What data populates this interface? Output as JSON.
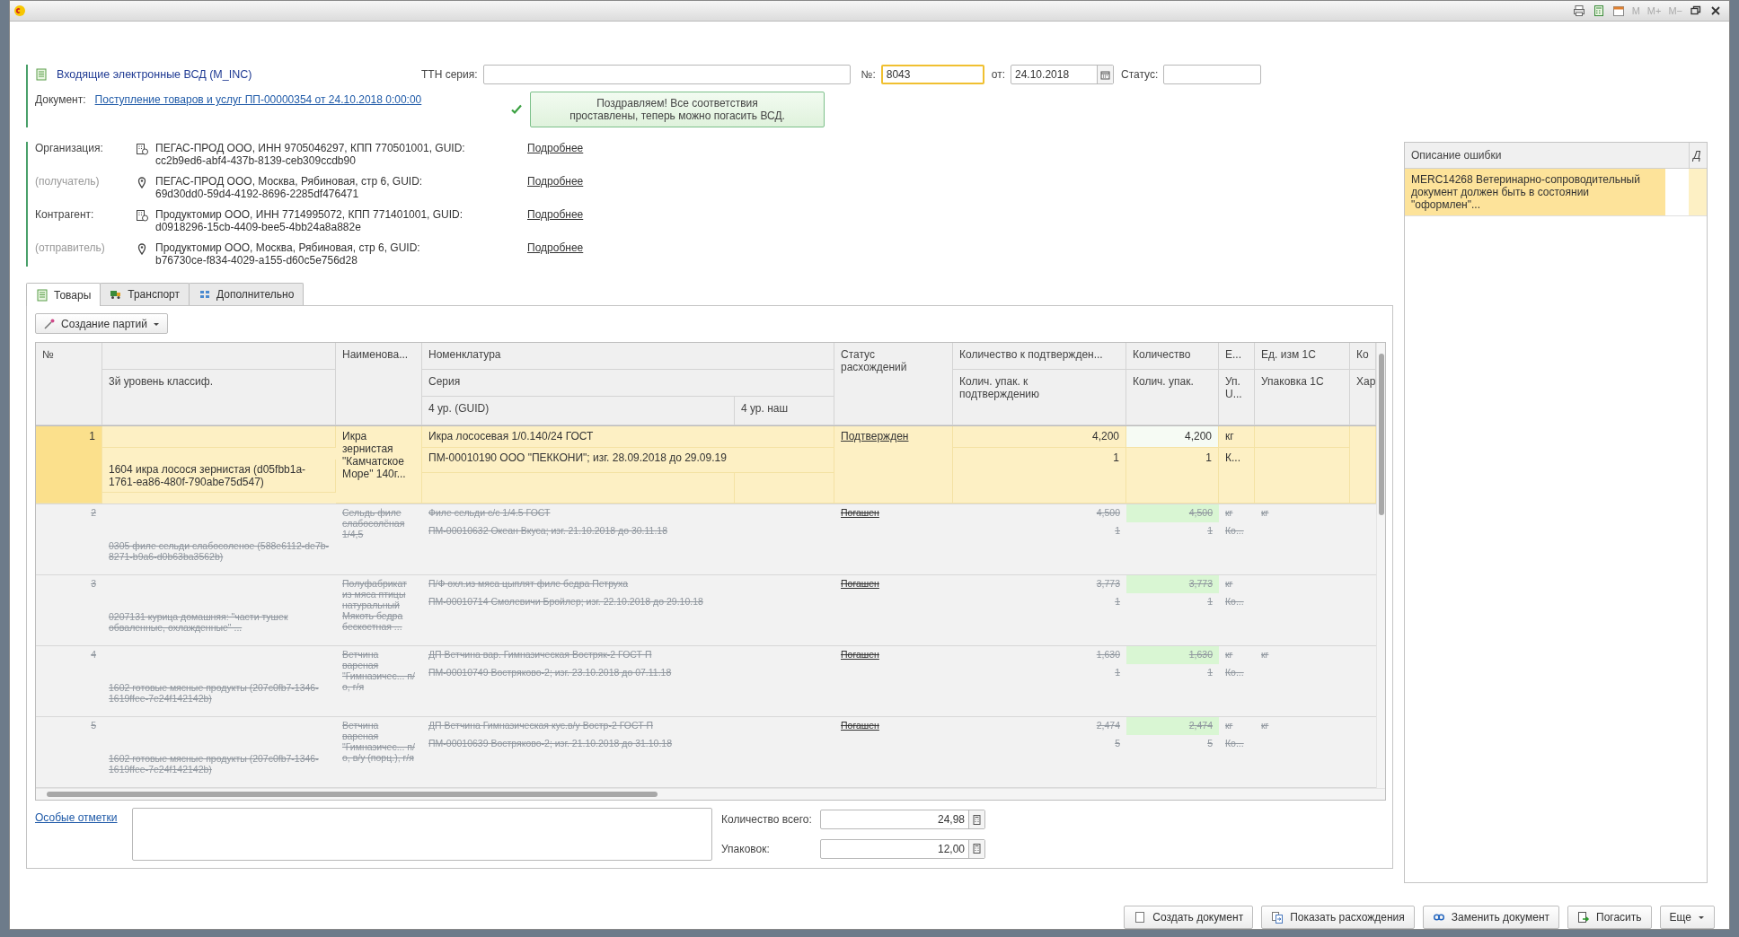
{
  "window": {
    "memory_buttons": [
      "M",
      "M+",
      "M−"
    ]
  },
  "header": {
    "title": "Входящие электронные ВСД (M_INC)",
    "ttn_label": "ТТН серия:",
    "number_label": "№:",
    "number": "8043",
    "date_label": "от:",
    "date": "24.10.2018",
    "status_label": "Статус:",
    "document_label": "Документ:",
    "document_link": "Поступление товаров и услуг ПП-00000354 от 24.10.2018 0:00:00",
    "notice": "Поздравляем! Все соответствия проставлены, теперь можно погасить ВСД."
  },
  "parties": [
    {
      "label": "Организация:",
      "muted": false,
      "kind": "organization",
      "text": "ПЕГАС-ПРОД ООО,  ИНН 9705046297, КПП 770501001, GUID:",
      "guid": "cc2b9ed6-abf4-437b-8139-ceb309ccdb90",
      "link": "Подробнее"
    },
    {
      "label": "(получатель)",
      "muted": true,
      "kind": "place",
      "text": "ПЕГАС-ПРОД ООО, Москва, Рябиновая, стр 6, GUID:",
      "guid": "69d30dd0-59d4-4192-8696-2285df476471",
      "link": "Подробнее"
    },
    {
      "label": "Контрагент:",
      "muted": false,
      "kind": "organization",
      "text": "Продуктомир ООО,  ИНН 7714995072, КПП 771401001, GUID:",
      "guid": "d0918296-15cb-4409-bee5-4bb24a8a882e",
      "link": "Подробнее"
    },
    {
      "label": "(отправитель)",
      "muted": true,
      "kind": "place",
      "text": "Продуктомир ООО, Москва, Рябиновая, стр 6, GUID:",
      "guid": "b76730ce-f834-4029-a155-d60c5e756d28",
      "link": "Подробнее"
    }
  ],
  "tabs": [
    {
      "label": "Товары",
      "kind": "goods",
      "selected": true
    },
    {
      "label": "Транспорт",
      "kind": "transport",
      "selected": false
    },
    {
      "label": "Дополнительно",
      "kind": "extra",
      "selected": false
    }
  ],
  "toolbar": {
    "create_batches": "Создание партий"
  },
  "table": {
    "header": {
      "number": "№",
      "classifier": "3й уровень классиф.",
      "name": "Наименова...",
      "nomenclature": "Номенклатура",
      "series": "Серия",
      "guid": "4 ур. (GUID)",
      "own": "4 ур. наш",
      "status": "Статус расхождений",
      "qty_to_confirm": "Количество к подтвержден...",
      "packs_to_confirm": "Колич. упак. к подтверждению",
      "qty": "Количество",
      "packs": "Колич. упак.",
      "unit": "Е...",
      "pack_unit": "Уп. U...",
      "unit_1c": "Ед. изм 1С",
      "pack_1c": "Упаковка 1С",
      "column_11": "Ко",
      "column_11_sub": "Хар"
    },
    "rows": [
      {
        "number": "1",
        "selected": true,
        "written_off": false,
        "classifier": "1604 икра лосося зернистая (d05fbb1a-1761-ea86-480f-790abe75d547)",
        "name": "Икра зернистая \"Камчатское Море\" 140г...",
        "nomenclature": "Икра лососевая 1/0.140/24 ГОСТ",
        "series": "ПМ-00010190 ООО \"ПЕККОНИ\"; изг. 28.09.2018 до 29.09.19",
        "status": "Подтвержден",
        "qty_to_confirm": "4,200",
        "qty": "4,200",
        "unit": "кг",
        "packs_to_confirm": "1",
        "packs": "1",
        "pack_unit": "К..."
      },
      {
        "number": "2",
        "selected": false,
        "written_off": true,
        "classifier": "0305 филе сельди слабосоленое (588e6112-de7b-8271-b9a6-d0b63ba3562b)",
        "name": "Сельдь филе слабосолёная 1/4,5",
        "nomenclature": "Филе сельди с/с 1/4.5 ГОСТ",
        "series": "ПМ-00010632 Океан Вкуса; изг. 21.10.2018 до 30.11.18",
        "status": "Погашен",
        "qty_to_confirm": "4,500",
        "qty": "4,500",
        "unit": "кг",
        "unit_1c": "кг",
        "packs_to_confirm": "1",
        "packs": "1",
        "pack_unit": "Ко..."
      },
      {
        "number": "3",
        "selected": false,
        "written_off": true,
        "classifier": "0207131 курица домашняя: \"части тушек обваленные, охлажденные\" ...",
        "name": "Полуфабрикат из мяса птицы натуральный Мякоть бедра бескостная ...",
        "nomenclature": "П/Ф охл.из мяса цыплят филе бедра Петруха",
        "series": "ПМ-00010714 Смолевичи Бройлер; изг. 22.10.2018 до 29.10.18",
        "status": "Погашен",
        "qty_to_confirm": "3,773",
        "qty": "3,773",
        "unit": "кг",
        "packs_to_confirm": "1",
        "packs": "1",
        "pack_unit": "Ко..."
      },
      {
        "number": "4",
        "selected": false,
        "written_off": true,
        "classifier": "1602 готовые мясные продукты (207c0fb7-1346-1619ffee-7e24f142142b)",
        "name": "Ветчина вареная \"Гимназичес... п/о, г/я",
        "nomenclature": "ДП Ветчина вар. Гимназическая Востряк-2 ГОСТ П",
        "series": "ПМ-00010749 Востряково-2; изг. 23.10.2018 до 07.11.18",
        "status": "Погашен",
        "qty_to_confirm": "1,630",
        "qty": "1,630",
        "unit": "кг",
        "unit_1c": "кг",
        "packs_to_confirm": "1",
        "packs": "1",
        "pack_unit": "Ко..."
      },
      {
        "number": "5",
        "selected": false,
        "written_off": true,
        "classifier": "1602 готовые мясные продукты (207c0fb7-1346-1619ffee-7e24f142142b)",
        "name": "Ветчина вареная \"Гимназичес... п/о, в/у (порц.), г/я",
        "nomenclature": "ДП Ветчина Гимназическая кус.в/у Востр-2 ГОСТ П",
        "series": "ПМ-00010639 Востряково-2; изг. 21.10.2018 до 31.10.18",
        "status": "Погашен",
        "qty_to_confirm": "2,474",
        "qty": "2,474",
        "unit": "кг",
        "unit_1c": "кг",
        "packs_to_confirm": "5",
        "packs": "5",
        "pack_unit": "Ко..."
      }
    ]
  },
  "footer": {
    "notes_link": "Особые отметки",
    "total_label": "Количество всего:",
    "total": "24,98",
    "packs_label": "Упаковок:",
    "packs": "12,00"
  },
  "errors": {
    "columns": [
      "Описание ошибки",
      "Д"
    ],
    "rows": [
      {
        "text": "MERC14268 Ветеринарно-сопроводительный документ должен быть в состоянии \"оформлен\"...",
        "selected": true
      }
    ]
  },
  "actions": [
    {
      "label": "Создать документ",
      "kind": "create"
    },
    {
      "label": "Показать расхождения",
      "kind": "compare"
    },
    {
      "label": "Заменить документ",
      "kind": "replace"
    },
    {
      "label": "Погасить",
      "kind": "writeoff"
    },
    {
      "label": "Еще",
      "kind": "more"
    }
  ]
}
